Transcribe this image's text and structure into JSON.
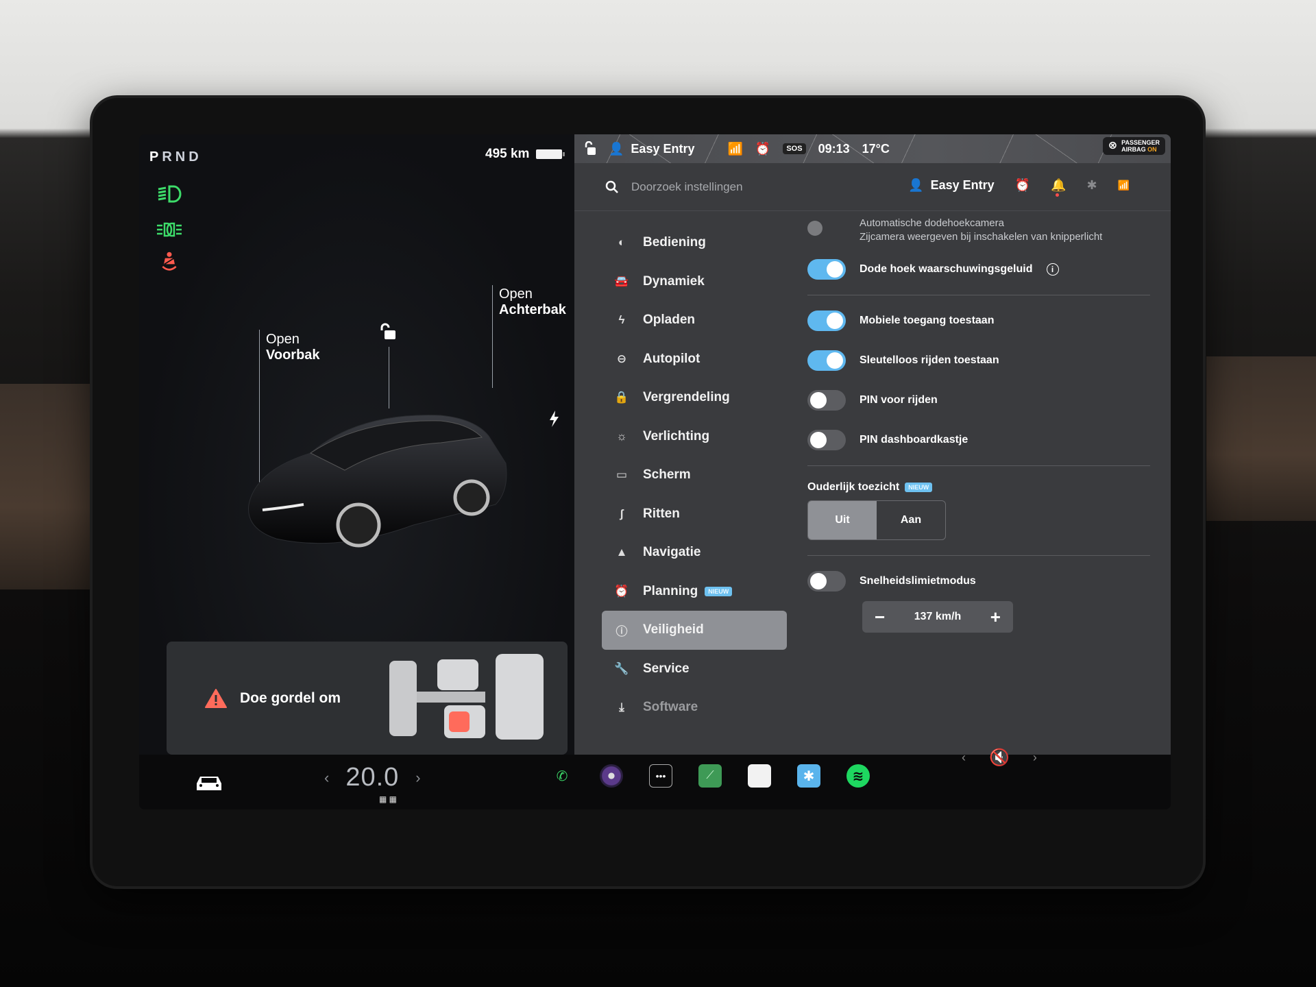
{
  "drive": {
    "gears": [
      "P",
      "R",
      "N",
      "D"
    ],
    "active_gear": "P",
    "range": "495 km",
    "indicators": [
      "low-beam-headlight-icon",
      "parking-lights-icon",
      "seatbelt-warning-icon"
    ],
    "indicator_colors": {
      "lights": "#3ddc6a",
      "seatbelt": "#ff5a4e"
    }
  },
  "car_view": {
    "frunk_label_top": "Open",
    "frunk_label_bottom": "Voorbak",
    "trunk_label_top": "Open",
    "trunk_label_bottom": "Achterbak",
    "lock_state": "unlocked",
    "charge_port_icon": "lightning-icon"
  },
  "alert": {
    "message": "Doe gordel om",
    "icon": "warning-triangle-icon",
    "color": "#ff6b5b"
  },
  "status_bar": {
    "profile": "Easy Entry",
    "sos": "SOS",
    "time": "09:13",
    "temperature": "17°C",
    "airbag_line1": "PASSENGER",
    "airbag_line2": "AIRBAG",
    "airbag_state": "ON"
  },
  "settings": {
    "search_placeholder": "Doorzoek instellingen",
    "profile": "Easy Entry",
    "header_icons": [
      "alarm-clock-icon",
      "notification-bell-icon",
      "bluetooth-icon",
      "wifi-icon"
    ],
    "nav": [
      {
        "label": "Bediening",
        "icon": "toggle-icon"
      },
      {
        "label": "Dynamiek",
        "icon": "car-front-icon"
      },
      {
        "label": "Opladen",
        "icon": "lightning-icon"
      },
      {
        "label": "Autopilot",
        "icon": "steering-wheel-icon"
      },
      {
        "label": "Vergrendeling",
        "icon": "lock-icon"
      },
      {
        "label": "Verlichting",
        "icon": "sun-icon"
      },
      {
        "label": "Scherm",
        "icon": "display-icon"
      },
      {
        "label": "Ritten",
        "icon": "trips-icon"
      },
      {
        "label": "Navigatie",
        "icon": "navigation-arrow-icon"
      },
      {
        "label": "Planning",
        "icon": "alarm-clock-icon",
        "badge": "NIEUW"
      },
      {
        "label": "Veiligheid",
        "icon": "alert-circle-icon",
        "active": true
      },
      {
        "label": "Service",
        "icon": "wrench-icon"
      },
      {
        "label": "Software",
        "icon": "download-icon"
      }
    ],
    "content": {
      "auto_blindspot_camera": {
        "label": "Automatische dodehoekcamera",
        "description": "Zijcamera weergeven bij inschakelen van knipperlicht",
        "state": "disabled"
      },
      "blindspot_chime": {
        "label": "Dode hoek waarschuwingsgeluid",
        "state": "on"
      },
      "mobile_access": {
        "label": "Mobiele toegang toestaan",
        "state": "on"
      },
      "keyless_driving": {
        "label": "Sleutelloos rijden toestaan",
        "state": "on"
      },
      "pin_to_drive": {
        "label": "PIN voor rijden",
        "state": "off"
      },
      "glovebox_pin": {
        "label": "PIN dashboardkastje",
        "state": "off"
      },
      "parental_controls": {
        "label": "Ouderlijk toezicht",
        "badge": "NIEUW",
        "options": [
          "Uit",
          "Aan"
        ],
        "selected": "Uit"
      },
      "speed_limit_mode": {
        "label": "Snelheidslimietmodus",
        "state": "off",
        "value": "137 km/h",
        "minus": "−",
        "plus": "+"
      }
    }
  },
  "bottom_bar": {
    "climate_temp": "20.0",
    "climate_left": "‹",
    "climate_right": "›",
    "dock_apps": [
      "phone-icon",
      "camera-icon",
      "more-apps-icon",
      "energy-app-icon",
      "calendar-icon",
      "bluetooth-app-icon",
      "spotify-icon"
    ],
    "volume": "muted",
    "vol_left": "‹",
    "vol_right": "›"
  },
  "colors": {
    "accent_toggle": "#5fb8ef",
    "spotify": "#1ed760",
    "phone": "#3ddc6a",
    "airbag_on": "#f5a623"
  }
}
